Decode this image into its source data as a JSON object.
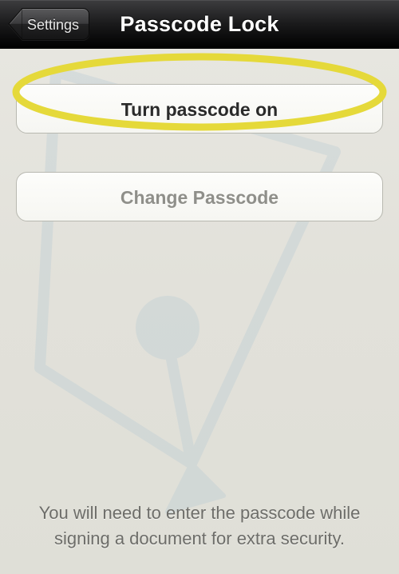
{
  "navbar": {
    "back_label": "Settings",
    "title": "Passcode Lock"
  },
  "buttons": {
    "turn_on_label": "Turn passcode on",
    "change_label": "Change Passcode"
  },
  "footer": {
    "text": "You will need to enter the passcode while signing a document for extra security."
  }
}
